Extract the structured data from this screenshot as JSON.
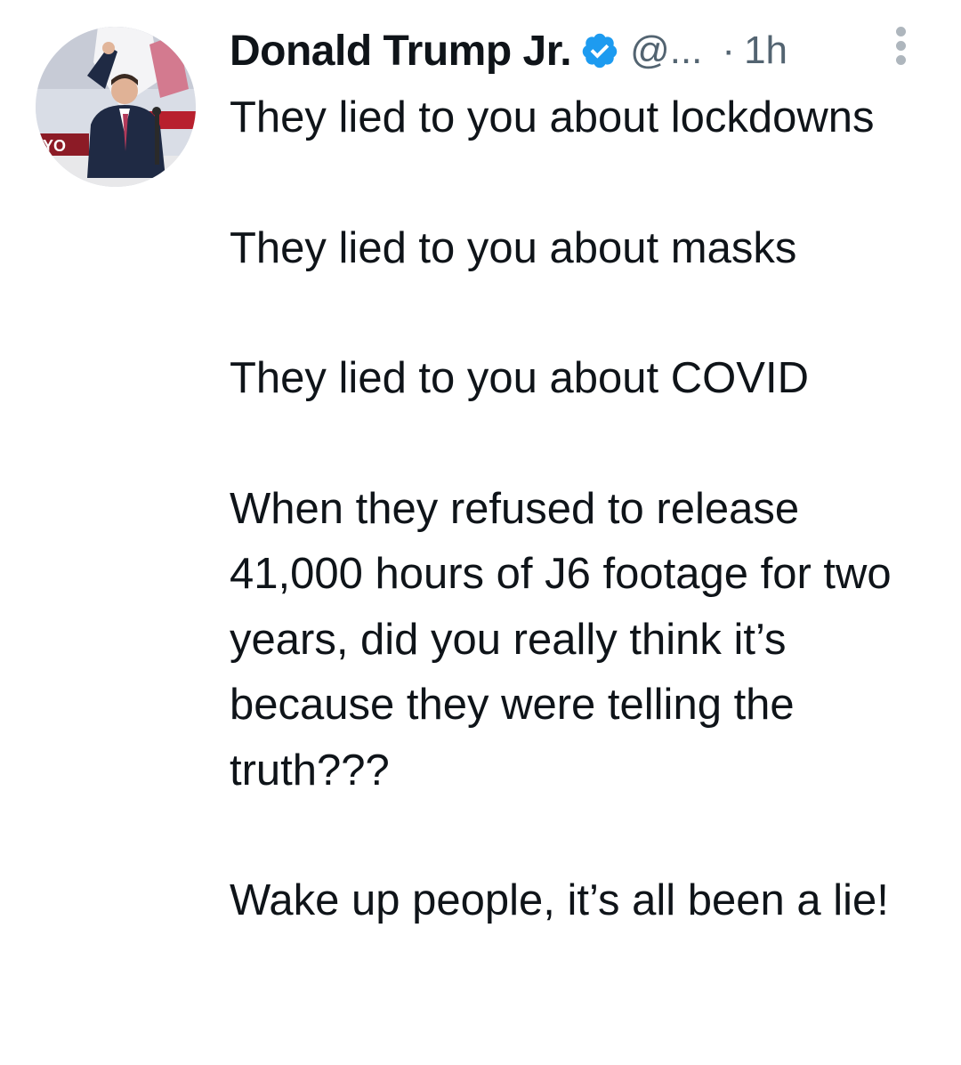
{
  "tweet": {
    "author": {
      "display_name": "Donald Trump Jr.",
      "handle": "@...",
      "verified_icon": "verified-badge-icon",
      "avatar": "profile-photo"
    },
    "separator": "·",
    "timestamp": "1h",
    "more_icon": "more-vertical-icon",
    "paragraphs": [
      "They lied to you about lockdowns",
      "They lied to you about masks",
      "They lied to you about COVID",
      "When they refused to release 41,000 hours of J6 footage for two years, did you really think it’s because they were telling the truth???",
      "Wake up people, it’s all been a lie!"
    ]
  },
  "colors": {
    "text_primary": "#0f1419",
    "text_secondary": "#536471",
    "verified_blue": "#1d9bf0",
    "more_dots": "#aeb6bd"
  }
}
